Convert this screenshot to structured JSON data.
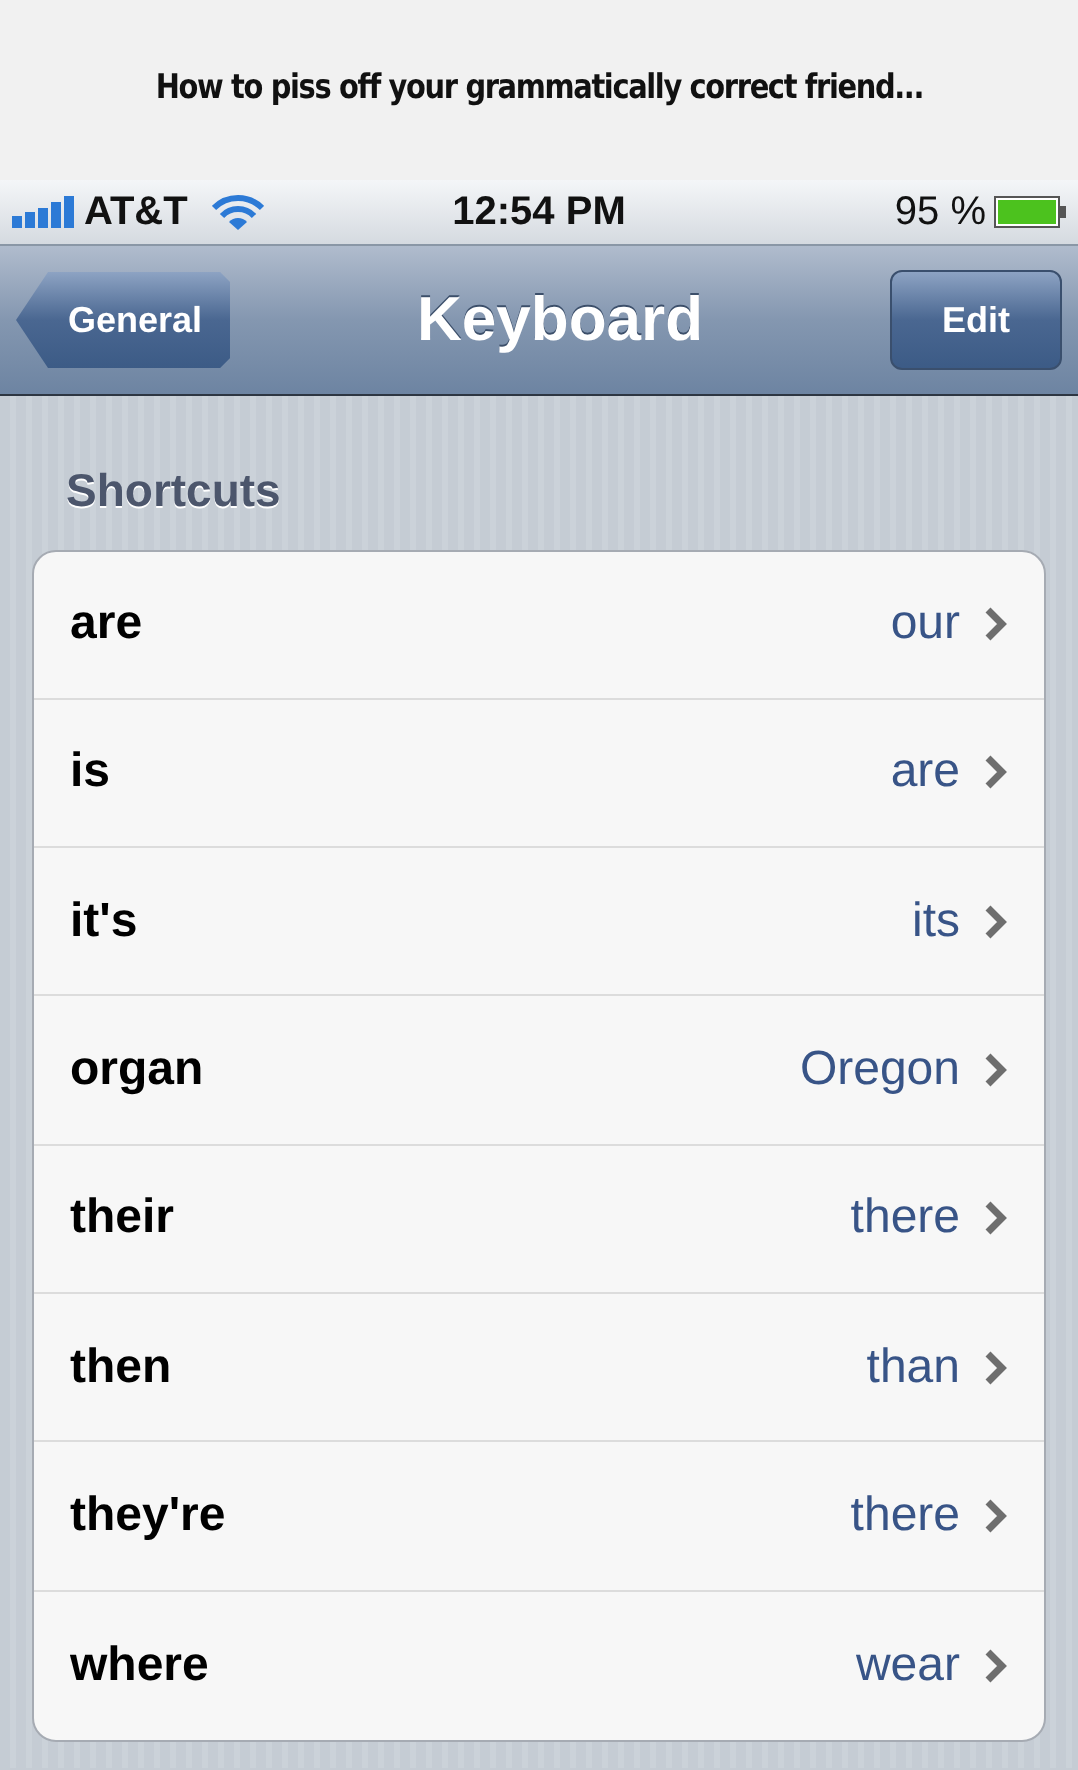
{
  "caption": "How to piss off your grammatically correct friend...",
  "status_bar": {
    "carrier": "AT&T",
    "time": "12:54 PM",
    "battery": "95 %"
  },
  "nav_bar": {
    "back": "General",
    "title": "Keyboard",
    "action": "Edit"
  },
  "section": {
    "title": "Shortcuts",
    "rows": [
      {
        "phrase": "are",
        "shortcut": "our"
      },
      {
        "phrase": "is",
        "shortcut": "are"
      },
      {
        "phrase": "it's",
        "shortcut": "its"
      },
      {
        "phrase": "organ",
        "shortcut": "Oregon"
      },
      {
        "phrase": "their",
        "shortcut": "there"
      },
      {
        "phrase": "then",
        "shortcut": "than"
      },
      {
        "phrase": "they're",
        "shortcut": "there"
      },
      {
        "phrase": "where",
        "shortcut": "wear"
      }
    ]
  }
}
